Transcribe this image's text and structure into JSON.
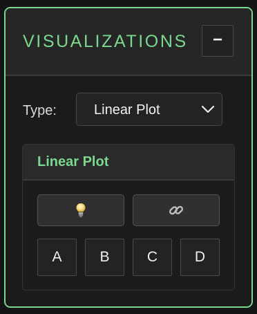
{
  "panel": {
    "title": "VISUALIZATIONS",
    "collapse_label": "−",
    "accent_color": "#7bd88f"
  },
  "type_selector": {
    "label": "Type:",
    "selected": "Linear Plot"
  },
  "card": {
    "title": "Linear Plot",
    "icon_buttons": [
      {
        "icon": "lightbulb-icon"
      },
      {
        "icon": "link-icon"
      }
    ],
    "letter_buttons": [
      "A",
      "B",
      "C",
      "D"
    ]
  }
}
